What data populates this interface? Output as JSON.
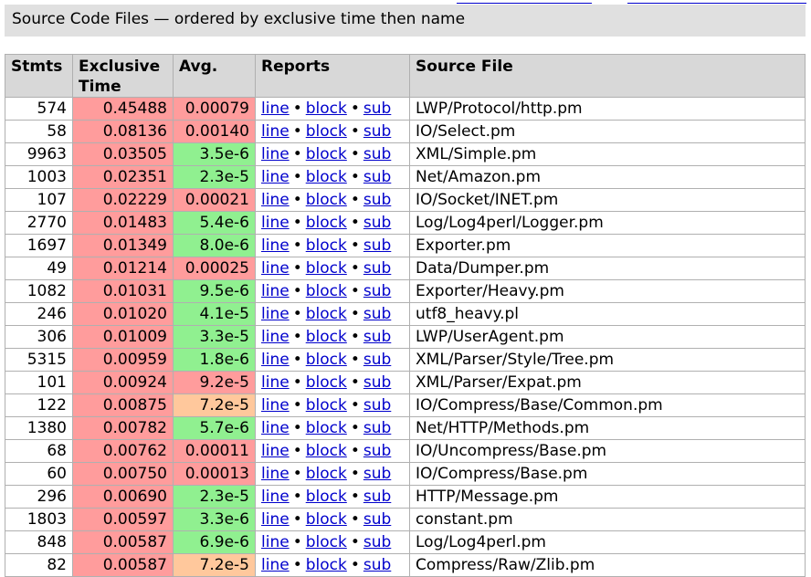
{
  "caption": "Source Code Files — ordered by exclusive time then name",
  "headers": {
    "stmts": "Stmts",
    "exclusive_time": "Exclusive Time",
    "avg": "Avg.",
    "reports": "Reports",
    "source_file": "Source File"
  },
  "report_links": {
    "line": "line",
    "block": "block",
    "sub": "sub",
    "separator": "•"
  },
  "colors": {
    "red": "#ff9c9c",
    "green": "#90f090",
    "orange": "#ffc89c",
    "link": "#0000cc",
    "header_bg": "#d8d8d8"
  },
  "rows": [
    {
      "stmts": "574",
      "time": "0.45488",
      "avg": "0.00079",
      "avg_color": "red",
      "file": "LWP/Protocol/http.pm"
    },
    {
      "stmts": "58",
      "time": "0.08136",
      "avg": "0.00140",
      "avg_color": "red",
      "file": "IO/Select.pm"
    },
    {
      "stmts": "9963",
      "time": "0.03505",
      "avg": "3.5e-6",
      "avg_color": "green",
      "file": "XML/Simple.pm"
    },
    {
      "stmts": "1003",
      "time": "0.02351",
      "avg": "2.3e-5",
      "avg_color": "green",
      "file": "Net/Amazon.pm"
    },
    {
      "stmts": "107",
      "time": "0.02229",
      "avg": "0.00021",
      "avg_color": "red",
      "file": "IO/Socket/INET.pm"
    },
    {
      "stmts": "2770",
      "time": "0.01483",
      "avg": "5.4e-6",
      "avg_color": "green",
      "file": "Log/Log4perl/Logger.pm"
    },
    {
      "stmts": "1697",
      "time": "0.01349",
      "avg": "8.0e-6",
      "avg_color": "green",
      "file": "Exporter.pm"
    },
    {
      "stmts": "49",
      "time": "0.01214",
      "avg": "0.00025",
      "avg_color": "red",
      "file": "Data/Dumper.pm"
    },
    {
      "stmts": "1082",
      "time": "0.01031",
      "avg": "9.5e-6",
      "avg_color": "green",
      "file": "Exporter/Heavy.pm"
    },
    {
      "stmts": "246",
      "time": "0.01020",
      "avg": "4.1e-5",
      "avg_color": "green",
      "file": "utf8_heavy.pl"
    },
    {
      "stmts": "306",
      "time": "0.01009",
      "avg": "3.3e-5",
      "avg_color": "green",
      "file": "LWP/UserAgent.pm"
    },
    {
      "stmts": "5315",
      "time": "0.00959",
      "avg": "1.8e-6",
      "avg_color": "green",
      "file": "XML/Parser/Style/Tree.pm"
    },
    {
      "stmts": "101",
      "time": "0.00924",
      "avg": "9.2e-5",
      "avg_color": "red",
      "file": "XML/Parser/Expat.pm"
    },
    {
      "stmts": "122",
      "time": "0.00875",
      "avg": "7.2e-5",
      "avg_color": "orange",
      "file": "IO/Compress/Base/Common.pm"
    },
    {
      "stmts": "1380",
      "time": "0.00782",
      "avg": "5.7e-6",
      "avg_color": "green",
      "file": "Net/HTTP/Methods.pm"
    },
    {
      "stmts": "68",
      "time": "0.00762",
      "avg": "0.00011",
      "avg_color": "red",
      "file": "IO/Uncompress/Base.pm"
    },
    {
      "stmts": "60",
      "time": "0.00750",
      "avg": "0.00013",
      "avg_color": "red",
      "file": "IO/Compress/Base.pm"
    },
    {
      "stmts": "296",
      "time": "0.00690",
      "avg": "2.3e-5",
      "avg_color": "green",
      "file": "HTTP/Message.pm"
    },
    {
      "stmts": "1803",
      "time": "0.00597",
      "avg": "3.3e-6",
      "avg_color": "green",
      "file": "constant.pm"
    },
    {
      "stmts": "848",
      "time": "0.00587",
      "avg": "6.9e-6",
      "avg_color": "green",
      "file": "Log/Log4perl.pm"
    },
    {
      "stmts": "82",
      "time": "0.00587",
      "avg": "7.2e-5",
      "avg_color": "orange",
      "file": "Compress/Raw/Zlib.pm"
    }
  ]
}
